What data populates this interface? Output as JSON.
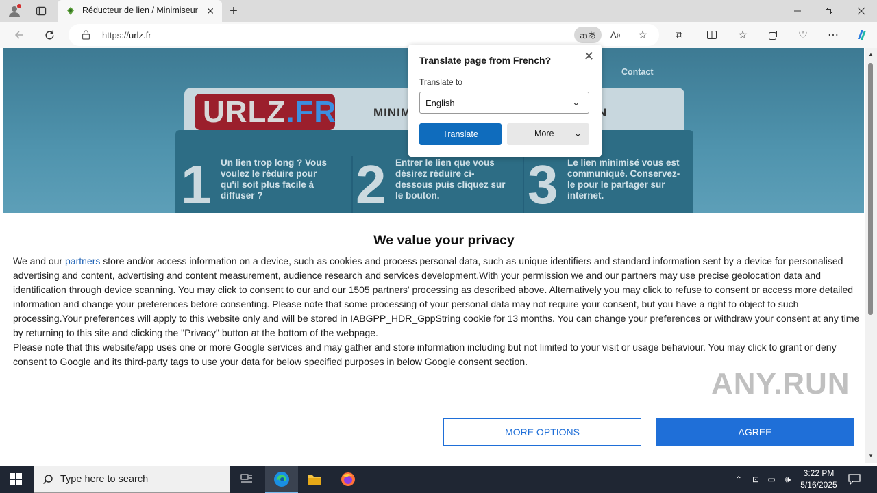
{
  "browser": {
    "tab_title": "Réducteur de lien / Minimiseur d",
    "url_scheme": "https://",
    "url_host": "urlz.fr",
    "translate_chip": "ꜳあ"
  },
  "site": {
    "nav_contact": "Contact",
    "logo_main": "URLZ",
    "logo_ext": ".FR",
    "title_start": "MINIMI",
    "title_end": "N",
    "steps": [
      {
        "num": "1",
        "text": "Un lien trop long ? Vous voulez le réduire pour qu'il soit plus facile à diffuser ?"
      },
      {
        "num": "2",
        "text": "Entrer le lien que vous désirez réduire ci-dessous puis cliquez sur le bouton."
      },
      {
        "num": "3",
        "text": "Le lien minimisé vous est communiqué. Conservez-le pour le partager sur internet."
      }
    ]
  },
  "consent": {
    "title": "We value your privacy",
    "p1_prefix": "We and our ",
    "p1_link": "partners",
    "p1_rest": " store and/or access information on a device, such as cookies and process personal data, such as unique identifiers and standard information sent by a device for personalised advertising and content, advertising and content measurement, audience research and services development.With your permission we and our partners may use precise geolocation data and identification through device scanning. You may click to consent to our and our 1505 partners' processing as described above. Alternatively you may click to refuse to consent or access more detailed information and change your preferences before consenting. Please note that some processing of your personal data may not require your consent, but you have a right to object to such processing.Your preferences will apply to this website only and will be stored in IABGPP_HDR_GppString cookie for 13 months. You can change your preferences or withdraw your consent at any time by returning to this site and clicking the \"Privacy\" button at the bottom of the webpage.",
    "p2": "Please note that this website/app uses one or more Google services and may gather and store information including but not limited to your visit or usage behaviour. You may click to grant or deny consent to Google and its third-party tags to use your data for below specified purposes in below Google consent section.",
    "more_options": "MORE OPTIONS",
    "agree": "AGREE",
    "watermark": "ANY.RUN"
  },
  "translate_popup": {
    "title": "Translate page from French?",
    "label": "Translate to",
    "selected_language": "English",
    "translate_button": "Translate",
    "more_button": "More"
  },
  "taskbar": {
    "search_placeholder": "Type here to search",
    "time": "3:22 PM",
    "date": "5/16/2025"
  },
  "colors": {
    "accent": "#1f6fd8",
    "edge_blue": "#0f6cbd",
    "site_teal": "#3d7a93"
  },
  "icons": [
    "profile-icon",
    "tab-actions-icon",
    "favicon-icon",
    "close-icon",
    "new-tab-icon",
    "minimize-icon",
    "maximize-icon",
    "back-icon",
    "refresh-icon",
    "lock-icon",
    "read-aloud-icon",
    "favorite-star-icon",
    "extensions-icon",
    "split-screen-icon",
    "favorites-icon",
    "collections-icon",
    "performance-icon",
    "more-icon",
    "copilot-icon",
    "windows-start-icon",
    "search-icon",
    "task-view-icon",
    "edge-icon",
    "file-explorer-icon",
    "firefox-icon",
    "notification-icon"
  ]
}
